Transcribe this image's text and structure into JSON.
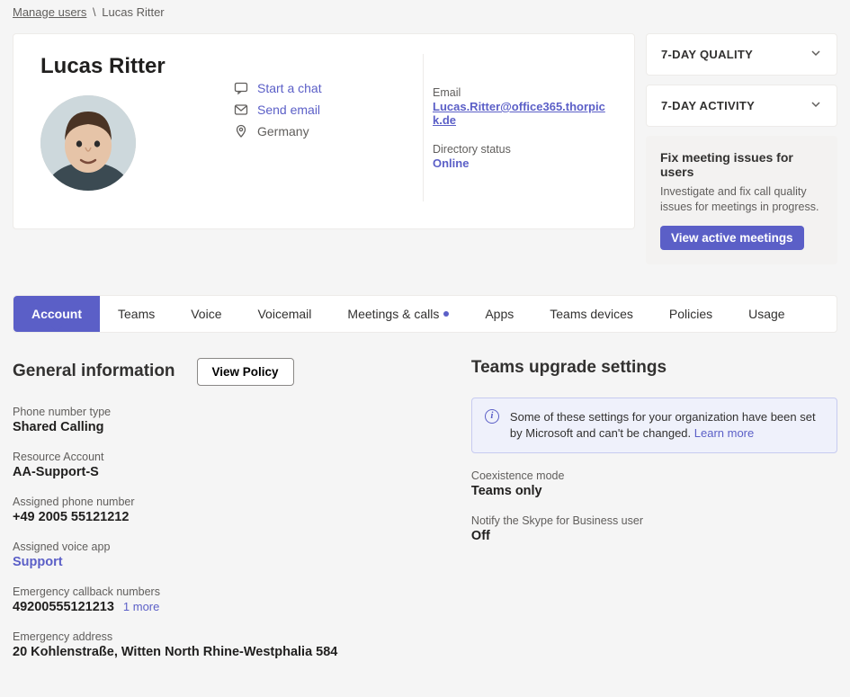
{
  "breadcrumb": {
    "parent": "Manage users",
    "current": "Lucas Ritter"
  },
  "profile": {
    "name": "Lucas Ritter",
    "actions": {
      "chat": "Start a chat",
      "email": "Send email",
      "location": "Germany"
    },
    "email_label": "Email",
    "email_value": "Lucas.Ritter@office365.thorpick.de",
    "dir_status_label": "Directory status",
    "dir_status_value": "Online"
  },
  "side": {
    "quality_title": "7-DAY QUALITY",
    "activity_title": "7-DAY ACTIVITY",
    "fix_title": "Fix meeting issues for users",
    "fix_desc": "Investigate and fix call quality issues for meetings in progress.",
    "fix_button": "View active meetings"
  },
  "tabs": [
    {
      "label": "Account",
      "active": true,
      "dot": false
    },
    {
      "label": "Teams",
      "active": false,
      "dot": false
    },
    {
      "label": "Voice",
      "active": false,
      "dot": false
    },
    {
      "label": "Voicemail",
      "active": false,
      "dot": false
    },
    {
      "label": "Meetings & calls",
      "active": false,
      "dot": true
    },
    {
      "label": "Apps",
      "active": false,
      "dot": false
    },
    {
      "label": "Teams devices",
      "active": false,
      "dot": false
    },
    {
      "label": "Policies",
      "active": false,
      "dot": false
    },
    {
      "label": "Usage",
      "active": false,
      "dot": false
    }
  ],
  "general": {
    "heading": "General information",
    "view_policy": "View Policy",
    "phone_type_label": "Phone number type",
    "phone_type_value": "Shared Calling",
    "resource_label": "Resource Account",
    "resource_value": "AA-Support-S",
    "assigned_num_label": "Assigned phone number",
    "assigned_num_value": "+49 2005 55121212",
    "voice_app_label": "Assigned voice app",
    "voice_app_value": "Support",
    "emergency_nums_label": "Emergency callback numbers",
    "emergency_nums_value": "49200555121213",
    "emergency_more": "1 more",
    "emergency_addr_label": "Emergency address",
    "emergency_addr_value": "20 Kohlenstraße, Witten North Rhine-Westphalia 584"
  },
  "upgrade": {
    "heading": "Teams upgrade settings",
    "banner_text": "Some of these settings for your organization have been set by Microsoft and can't be changed. ",
    "banner_link": "Learn more",
    "coexist_label": "Coexistence mode",
    "coexist_value": "Teams only",
    "notify_label": "Notify the Skype for Business user",
    "notify_value": "Off"
  }
}
